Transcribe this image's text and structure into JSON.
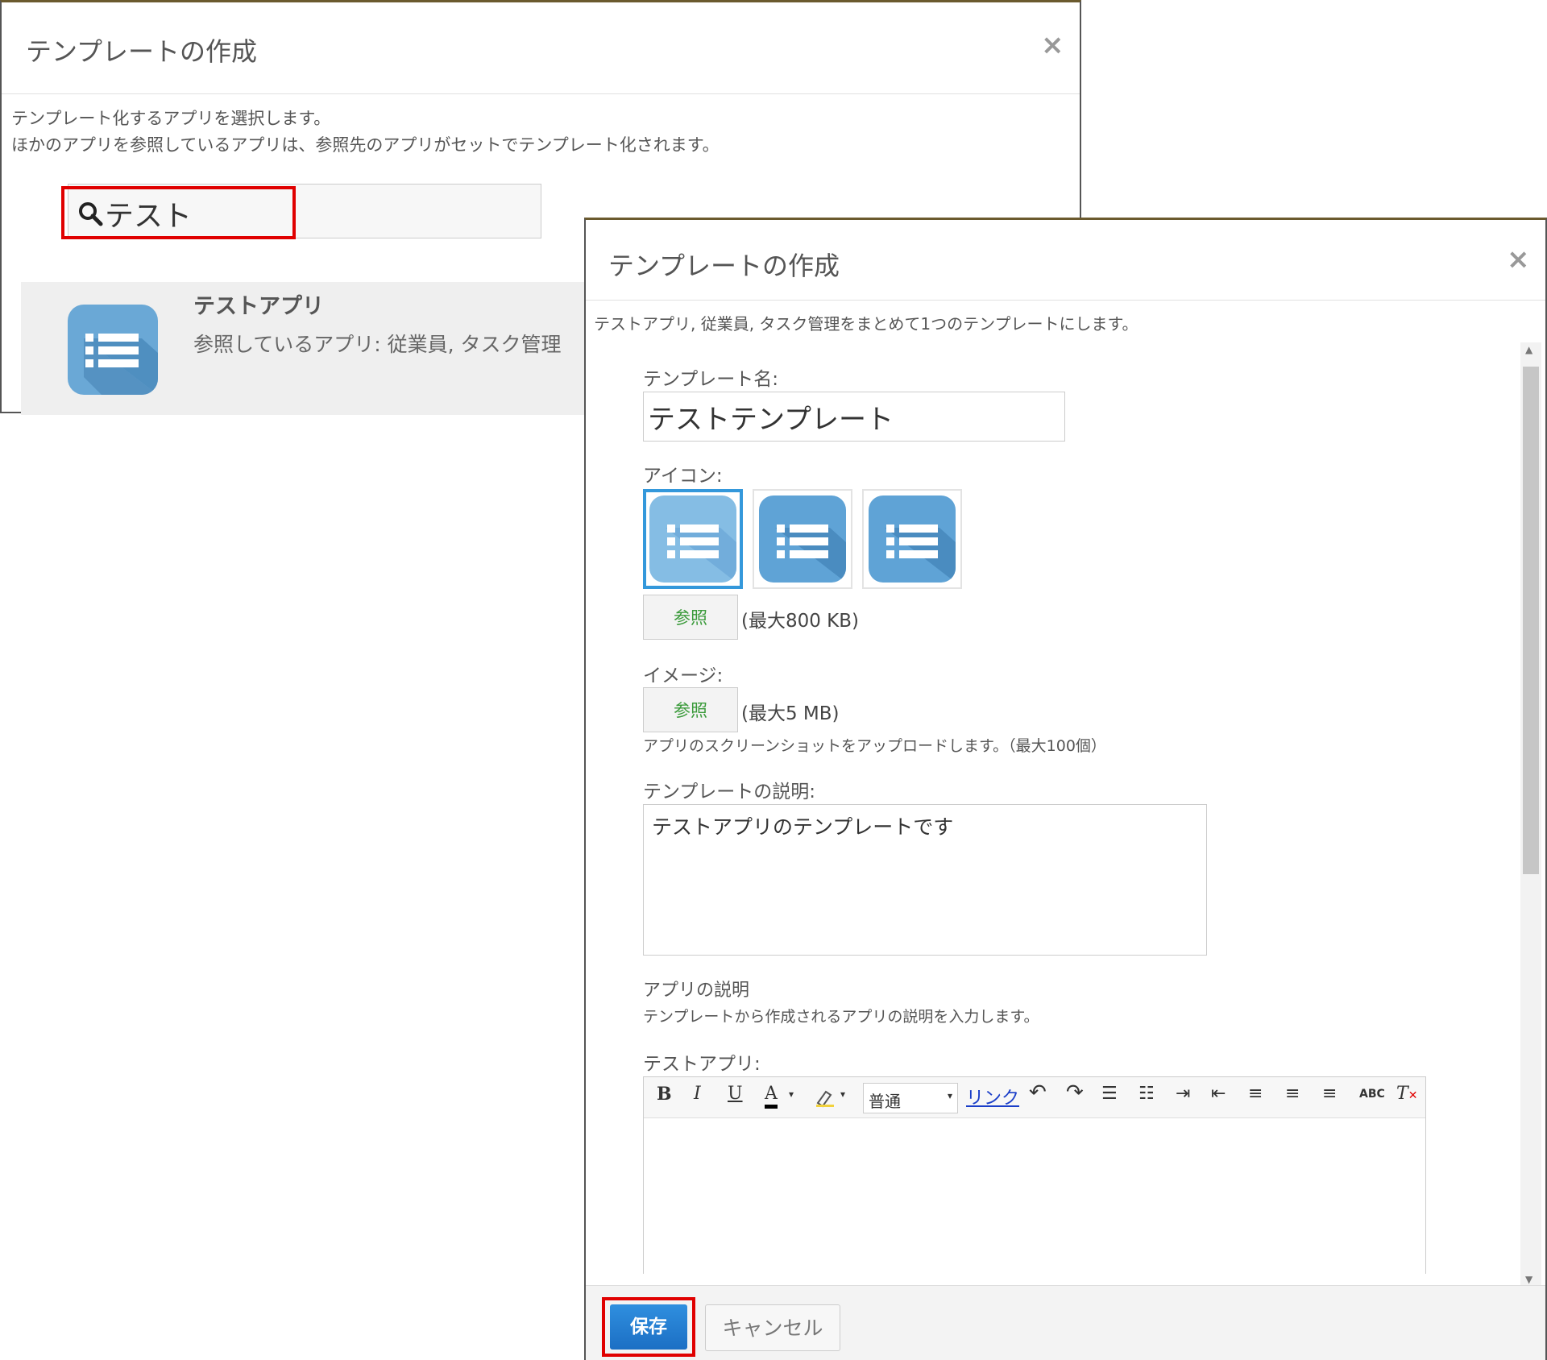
{
  "dialog_select": {
    "title": "テンプレートの作成",
    "close_label": "×",
    "instruction_1": "テンプレート化するアプリを選択します。",
    "instruction_2": "ほかのアプリを参照しているアプリは、参照先のアプリがセットでテンプレート化されます。",
    "search_value": "テスト",
    "result": {
      "app_name": "テストアプリ",
      "references": "参照しているアプリ: 従業員, タスク管理",
      "icon": "list-app-icon"
    }
  },
  "dialog_create": {
    "title": "テンプレートの作成",
    "close_label": "×",
    "intro": "テストアプリ, 従業員, タスク管理をまとめて1つのテンプレートにします。",
    "template_name_label": "テンプレート名:",
    "template_name_value": "テストテンプレート",
    "icon_label": "アイコン:",
    "icon_browse_label": "参照",
    "icon_size_note": "(最大800 KB)",
    "image_label": "イメージ:",
    "image_browse_label": "参照",
    "image_size_note": "(最大5 MB)",
    "image_hint": "アプリのスクリーンショットをアップロードします。（最大100個）",
    "description_label": "テンプレートの説明:",
    "description_value": "テストアプリのテンプレートです",
    "app_desc_heading": "アプリの説明",
    "app_desc_hint": "テンプレートから作成されるアプリの説明を入力します。",
    "app_desc_app_label": "テストアプリ:",
    "toolbar": {
      "bold": "B",
      "italic": "I",
      "underline": "U",
      "font_color": "A",
      "format_value": "普通",
      "link": "リンク",
      "spellcheck": "ABC"
    },
    "save_label": "保存",
    "cancel_label": "キャンセル"
  },
  "colors": {
    "accent_blue": "#1c6fc4",
    "highlight_red": "#e00000",
    "icon_blue": "#5fa3d6"
  }
}
